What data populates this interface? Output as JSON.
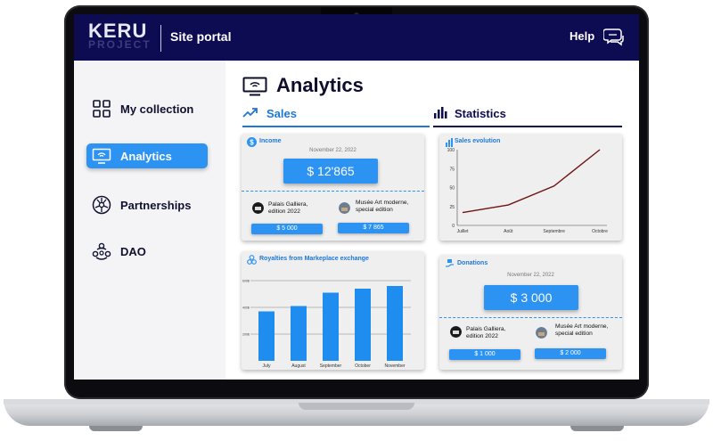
{
  "header": {
    "logo_text": "KERU",
    "logo_subtext": "PROJECT",
    "portal_title": "Site portal",
    "help_label": "Help"
  },
  "sidebar": {
    "items": [
      {
        "label": "My collection",
        "icon": "grid-icon"
      },
      {
        "label": "Analytics",
        "icon": "monitor-icon",
        "active": true
      },
      {
        "label": "Partnerships",
        "icon": "partnership-icon"
      },
      {
        "label": "DAO",
        "icon": "community-icon"
      }
    ]
  },
  "main": {
    "title": "Analytics",
    "tabs": [
      {
        "label": "Sales",
        "active": true
      },
      {
        "label": "Statistics"
      }
    ],
    "income": {
      "title": "Income",
      "date": "November 22, 2022",
      "amount": "$ 12'865",
      "events": [
        {
          "name": "Palais Galliera, edition 2022",
          "amount": "$ 5 000"
        },
        {
          "name": "Musée Art moderne, special edition",
          "amount": "$ 7 865"
        }
      ]
    },
    "donations": {
      "title": "Donations",
      "date": "November 22, 2022",
      "amount": "$ 3 000",
      "events": [
        {
          "name": "Palais Galliera, edition 2022",
          "amount": "$ 1 000"
        },
        {
          "name": "Musée Art moderne, special edition",
          "amount": "$ 2 000"
        }
      ]
    }
  },
  "chart_data": [
    {
      "type": "line",
      "title": "Sales evolution",
      "x": [
        "Juillet",
        "Août",
        "Septembre",
        "Octobre"
      ],
      "series": [
        {
          "values": [
            17,
            27,
            52,
            100
          ]
        }
      ],
      "ylim": [
        0,
        100
      ],
      "yticks": [
        0,
        25,
        50,
        75,
        100
      ],
      "grid": false,
      "color": "#6e1414"
    },
    {
      "type": "bar",
      "title": "Royalties from Markeplace exchange",
      "categories": [
        "July",
        "August",
        "September",
        "October",
        "November"
      ],
      "values": [
        370,
        410,
        510,
        540,
        560
      ],
      "yticks": [
        "200$",
        "400$",
        "600$"
      ],
      "ylim": [
        0,
        700
      ],
      "grid": true,
      "color": "#1f8df0"
    }
  ],
  "colors": {
    "header_bg": "#0d0b52",
    "accent": "#2d93f2",
    "tab_active": "#1e78d6"
  }
}
